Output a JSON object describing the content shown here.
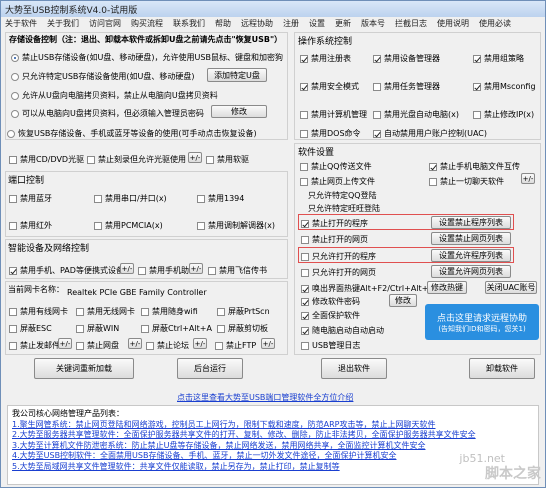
{
  "title": "大势至USB控制系统V4.0-试用版",
  "menu": [
    "关于软件",
    "关于我们",
    "访问官网",
    "购买流程",
    "联系我们",
    "帮助",
    "远程协助",
    "注册",
    "设置",
    "更新",
    "版本号",
    "拦截日志",
    "使用说明",
    "使用必读"
  ],
  "storage": {
    "header": "存储设备控制（注：退出、卸载本软件或拆卸U盘之前请先点击\"恢复USB\"）",
    "opt1": "禁止USB存储设备(如U盘、移动硬盘)，允许使用USB鼠标、键盘和加密狗",
    "opt2": "只允许特定USB存储设备使用(如U盘、移动硬盘)",
    "btn_add": "添加特定U盘",
    "opt3": "允许从U盘向电脑拷贝资料，禁止从电脑向U盘拷贝资料",
    "opt4": "可以从电脑向U盘拷贝资料，但必须输入管理员密码",
    "btn_edit": "修改",
    "opt5": "恢复USB存储设备、手机或蓝牙等设备的使用(可手动点击恢复设备)"
  },
  "cd": {
    "c1": "禁用CD/DVD光驱",
    "c2": "禁止刻录但允许光驱使用",
    "c3": "禁用软驱"
  },
  "port": {
    "header": "端口控制",
    "c1": "禁用蓝牙",
    "c2": "禁用串口/并口(x)",
    "c3": "禁用1394",
    "c4": "禁用红外",
    "c5": "禁用PCMCIA(x)",
    "c6": "禁用调制解调器(x)"
  },
  "smart": {
    "header": "智能设备及网络控制",
    "c1": "禁用手机、PAD等便携式设备",
    "c2": "禁用手机助手",
    "c3": "禁用飞信传书"
  },
  "nic": {
    "header": "当前网卡名称：",
    "name": "Realtek PCIe GBE Family Controller",
    "c1": "禁用有线网卡",
    "c2": "禁用无线网卡",
    "c3": "禁用随身wifi",
    "c4": "屏蔽PrtScn",
    "c5": "屏蔽ESC",
    "c6": "屏蔽WIN",
    "c7": "屏蔽Ctrl+Alt+A",
    "c8": "屏蔽剪切板",
    "c9": "禁止发邮件",
    "c10": "禁止网盘",
    "c11": "禁止论坛",
    "c12": "禁止FTP"
  },
  "os": {
    "header": "操作系统控制",
    "c1": "禁用注册表",
    "c2": "禁用设备管理器",
    "c3": "禁用组策略",
    "c4": "禁用安全模式",
    "c5": "禁用任务管理器",
    "c6": "禁用Msconfig",
    "c7": "禁用计算机管理",
    "c8": "禁用光盘自动电脑(x)",
    "c9": "禁止修改IP(x)",
    "c10": "禁用DOS命令",
    "c11": "自动禁用用户账户控制(UAC)"
  },
  "soft": {
    "header": "软件设置",
    "c1": "禁止QQ传送文件",
    "c2": "禁止手机电脑文件互传",
    "c3": "禁止网页上传文件",
    "c4": "禁止一切聊天软件",
    "c5": "只允许特定QQ登陆",
    "c6": "只允许特定旺旺登陆",
    "c7": "禁止打开的程序",
    "btn7": "设置禁止程序列表",
    "c8": "禁止打开的网页",
    "btn8": "设置禁止网页列表",
    "c9": "只允许打开的程序",
    "btn9": "设置允许程序列表",
    "c10": "只允许打开的网页",
    "btn10": "设置允许网页列表",
    "c11": "唤出界面热键Alt+F2/Ctrl+Alt+F2",
    "btn11": "修改热键",
    "btn12": "关闭UAC账号",
    "c12": "修改软件密码",
    "btn_edit": "修改",
    "c13": "全面保护软件",
    "c14": "随电脑启动自动启动",
    "c15": "USB管理日志"
  },
  "promo": {
    "line1": "点击这里请求远程协助",
    "line2": "(告知我们ID和密码，您关1)"
  },
  "buttons": {
    "reload": "关键词重新加载",
    "bg": "后台运行",
    "exit": "退出软件",
    "uninstall": "卸载软件"
  },
  "link": "点击这里查看大势至USB端口管理软件全方位介绍",
  "info": {
    "header": "我公司核心网络管理产品列表：",
    "lines": [
      "1.聚生网管系统：禁止网页登陆和网络游戏，控制员工上网行为，限制下载和速度，防范ARP攻击等，禁止上网聊天软件",
      "2.大势至服务器共享管理软件：全面保护服务器共享文件的打开、复制、修改、删除，防止非法拷贝，全面保护服务器共享文件安全",
      "3.大势至计算机文件防泄密系统：防止禁止U盘等存储设备，禁止网络发送，禁用网络共享，全面监控计算机文件安全",
      "4.大势至USB控制软件：全面禁用USB存储设备、手机、蓝牙，禁止一切外发文件途径，全面保护计算机安全",
      "5.大势至局域网共享文件管理软件：共享文件仅能读取，禁止另存为，禁止打印，禁止复制等"
    ]
  },
  "watermark": {
    "a": "jb51.net",
    "b": "脚本之家"
  }
}
